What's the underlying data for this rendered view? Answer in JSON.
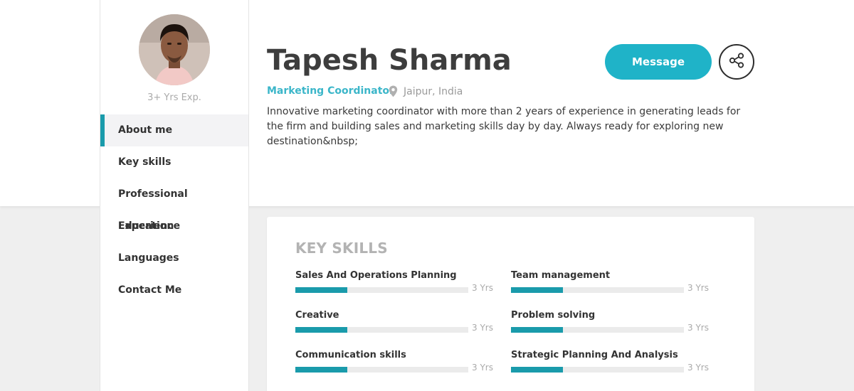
{
  "profile": {
    "name": "Tapesh Sharma",
    "role": "Marketing Coordinator",
    "location": "Jaipur, India",
    "experience": "3+ Yrs Exp.",
    "bio": "Innovative marketing coordinator with more than 2 years of experience in generating leads for the firm and building sales and marketing skills day by day. Always ready for exploring new destination&nbsp;"
  },
  "actions": {
    "message_label": "Message",
    "share_icon": "share-icon"
  },
  "sidebar": {
    "items": [
      {
        "label": "About me",
        "active": true
      },
      {
        "label": "Key skills",
        "active": false
      },
      {
        "label": "Professional Experience",
        "active": false
      },
      {
        "label": "Education",
        "active": false
      },
      {
        "label": "Languages",
        "active": false
      },
      {
        "label": "Contact Me",
        "active": false
      }
    ]
  },
  "skills": {
    "title": "KEY SKILLS",
    "items": [
      {
        "name": "Sales And Operations Planning",
        "years": "3 Yrs",
        "level": 0.3
      },
      {
        "name": "Team management",
        "years": "3 Yrs",
        "level": 0.3
      },
      {
        "name": "Creative",
        "years": "3 Yrs",
        "level": 0.3
      },
      {
        "name": "Problem solving",
        "years": "3 Yrs",
        "level": 0.3
      },
      {
        "name": "Communication skills",
        "years": "3 Yrs",
        "level": 0.3
      },
      {
        "name": "Strategic Planning And Analysis",
        "years": "3 Yrs",
        "level": 0.3
      }
    ]
  },
  "colors": {
    "accent": "#1fb3c8",
    "skill_bar": "#1a9bab",
    "role_text": "#3bb6c9"
  }
}
